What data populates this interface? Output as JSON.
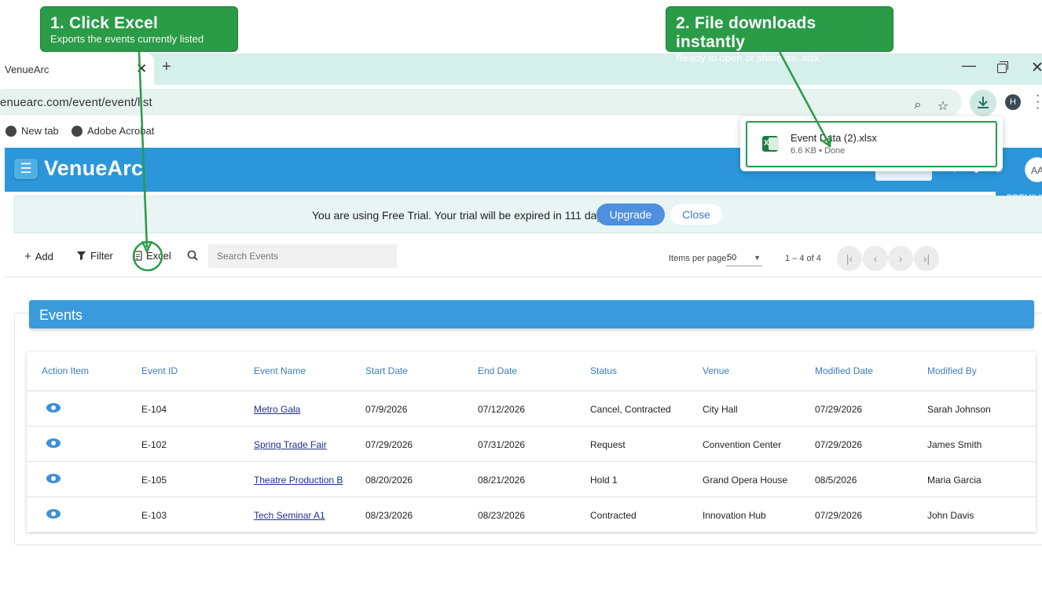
{
  "callouts": {
    "step1": {
      "title": "1. Click Excel",
      "subtitle": "Exports the events currently listed"
    },
    "step2": {
      "title": "2. File downloads instantly",
      "subtitle": "Ready to open or share as .xlsx"
    }
  },
  "browser": {
    "tab_title": "VenueArc",
    "tab_close": "✕",
    "new_tab": "+",
    "url": "enuearc.com/event/event/list",
    "bookmarks": [
      "New tab",
      "Adobe Acrobat"
    ],
    "profile_initial": "H",
    "window_controls": {
      "minimize": "—",
      "close": "✕"
    }
  },
  "download": {
    "file_name": "Event Data (2).xlsx",
    "meta": "6.6 KB • Done"
  },
  "app": {
    "brand": "VenueArc",
    "menu_icon": "☰",
    "avatar": "AA",
    "premium": "PREMIUM"
  },
  "trial": {
    "message": "You are using Free Trial. Your trial will be expired in 111 days.",
    "upgrade": "Upgrade",
    "close": "Close"
  },
  "actions": {
    "add": "Add",
    "filter": "Filter",
    "excel": "Excel",
    "search_placeholder": "Search Events",
    "items_per_page_label": "Items per page:",
    "items_per_page_value": "50",
    "range": "1 – 4 of 4"
  },
  "events": {
    "title": "Events",
    "columns": [
      "Action Item",
      "Event ID",
      "Event Name",
      "Start Date",
      "End Date",
      "Status",
      "Venue",
      "Modified Date",
      "Modified By"
    ],
    "rows": [
      {
        "id": "E-104",
        "name": "Metro Gala",
        "start": "07/9/2026",
        "end": "07/12/2026",
        "status": "Cancel, Contracted",
        "venue": "City Hall",
        "modified": "07/29/2026",
        "by": "Sarah Johnson"
      },
      {
        "id": "E-102",
        "name": "Spring Trade Fair",
        "start": "07/29/2026",
        "end": "07/31/2026",
        "status": "Request",
        "venue": "Convention Center",
        "modified": "07/29/2026",
        "by": "James Smith"
      },
      {
        "id": "E-105",
        "name": "Theatre Production B",
        "start": "08/20/2026",
        "end": "08/21/2026",
        "status": "Hold 1",
        "venue": "Grand Opera House",
        "modified": "08/5/2026",
        "by": "Maria Garcia"
      },
      {
        "id": "E-103",
        "name": "Tech Seminar A1",
        "start": "08/23/2026",
        "end": "08/23/2026",
        "status": "Contracted",
        "venue": "Innovation Hub",
        "modified": "07/29/2026",
        "by": "John Davis"
      }
    ]
  },
  "colors": {
    "accent": "#2b97da",
    "callout": "#2a9b47",
    "link": "#1f2f8f"
  }
}
